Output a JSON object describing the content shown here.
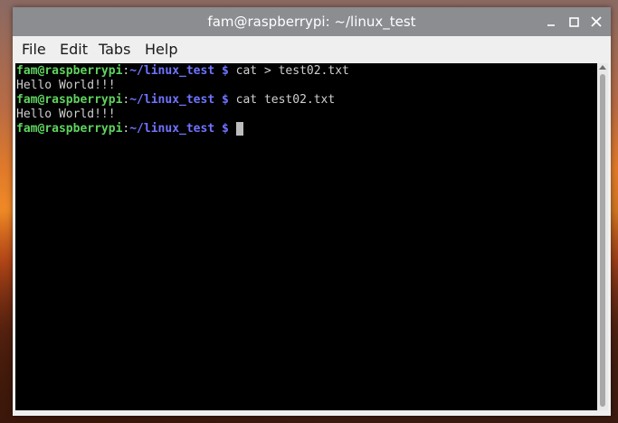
{
  "window": {
    "title": "fam@raspberrypi: ~/linux_test",
    "controls": {
      "minimize": "minimize-icon",
      "maximize": "maximize-icon",
      "close": "close-icon"
    }
  },
  "menu": [
    "File",
    "Edit",
    "Tabs",
    "Help"
  ],
  "terminal": {
    "lines": [
      {
        "type": "prompt",
        "user": "fam@raspberrypi",
        "colon": ":",
        "path": "~/linux_test",
        "sign": " $",
        "command": " cat > test02.txt"
      },
      {
        "type": "output",
        "text": "Hello World!!!"
      },
      {
        "type": "prompt",
        "user": "fam@raspberrypi",
        "colon": ":",
        "path": "~/linux_test",
        "sign": " $",
        "command": " cat test02.txt"
      },
      {
        "type": "output",
        "text": "Hello World!!!"
      },
      {
        "type": "prompt",
        "user": "fam@raspberrypi",
        "colon": ":",
        "path": "~/linux_test",
        "sign": " $",
        "command": " "
      }
    ]
  },
  "colors": {
    "prompt_user": "#5fd35f",
    "prompt_path": "#6f73ff",
    "output": "#cfcfcf",
    "background": "#000000"
  }
}
